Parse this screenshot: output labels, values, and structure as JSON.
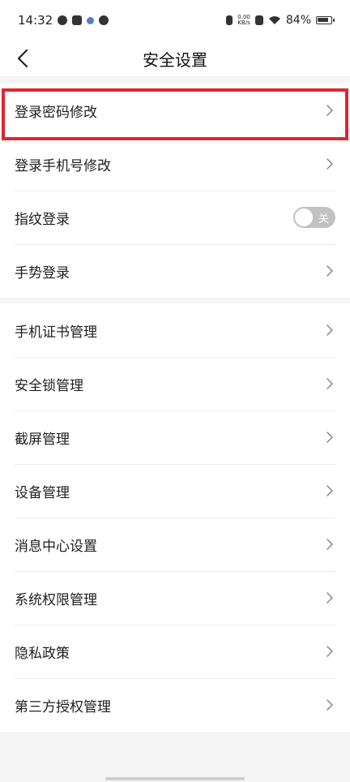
{
  "status_bar": {
    "time": "14:32",
    "net_speed_value": "0.00",
    "net_speed_unit": "KB/s",
    "battery": "84%"
  },
  "header": {
    "title": "安全设置"
  },
  "group1": {
    "items": [
      {
        "label": "登录密码修改",
        "type": "chevron"
      },
      {
        "label": "登录手机号修改",
        "type": "chevron"
      },
      {
        "label": "指纹登录",
        "type": "toggle",
        "toggle_text": "关",
        "on": false
      },
      {
        "label": "手势登录",
        "type": "chevron"
      }
    ]
  },
  "group2": {
    "items": [
      {
        "label": "手机证书管理"
      },
      {
        "label": "安全锁管理"
      },
      {
        "label": "截屏管理"
      },
      {
        "label": "设备管理"
      },
      {
        "label": "消息中心设置"
      },
      {
        "label": "系统权限管理"
      },
      {
        "label": "隐私政策"
      },
      {
        "label": "第三方授权管理"
      }
    ]
  },
  "colors": {
    "highlight": "#e0262e",
    "toggle_off": "#c2c2c2",
    "background": "#f5f5f5"
  }
}
